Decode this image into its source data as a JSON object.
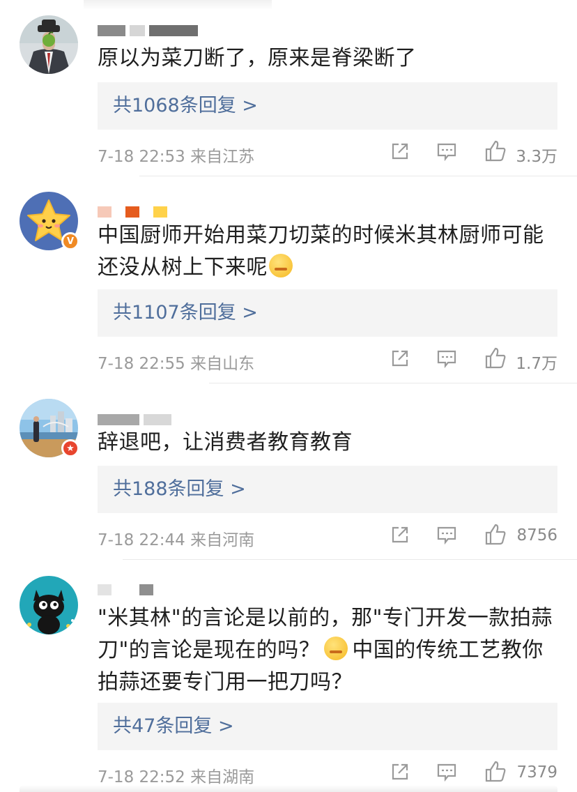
{
  "comments": [
    {
      "text": "原以为菜刀断了，原来是脊梁断了",
      "replies": "共1068条回复 >",
      "time": "7-18 22:53 来自江苏",
      "likes": "3.3万",
      "avatar": "surreal-man-green-apple",
      "badge": ""
    },
    {
      "text_line1": "中国厨师开始用菜刀切菜的时候米其林厨师可能",
      "text_line2": "还没从树上下来呢",
      "emoji": "yummy-face-emoji",
      "replies": "共1107条回复 >",
      "time": "7-18 22:55 来自山东",
      "likes": "1.7万",
      "avatar": "yellow-star",
      "badge": "V"
    },
    {
      "text": "辞退吧，让消费者教育教育",
      "replies": "共188条回复 >",
      "time": "7-18 22:44 来自河南",
      "likes": "8756",
      "avatar": "person-on-beach-city",
      "badge": "★"
    },
    {
      "text_line1": "\"米其林\"的言论是以前的，那\"专门开发一款拍蒜",
      "text_line2_a": "刀\"的言论是现在的吗？",
      "text_line2_b": "中国的传统工艺教你",
      "text_line3": "拍蒜还要专门用一把刀吗？",
      "emoji": "thinking-face-emoji",
      "replies": "共47条回复 >",
      "time": "7-18 22:52 来自湖南",
      "likes": "7379",
      "avatar": "cartoon-black-cat",
      "badge": ""
    }
  ],
  "colors": {
    "reply_link": "#4f6e9b",
    "reply_bg": "#f4f4f4",
    "meta_gray": "#9a9a9a",
    "badge_orange": "#f08a24",
    "badge_red": "#e8452e"
  }
}
